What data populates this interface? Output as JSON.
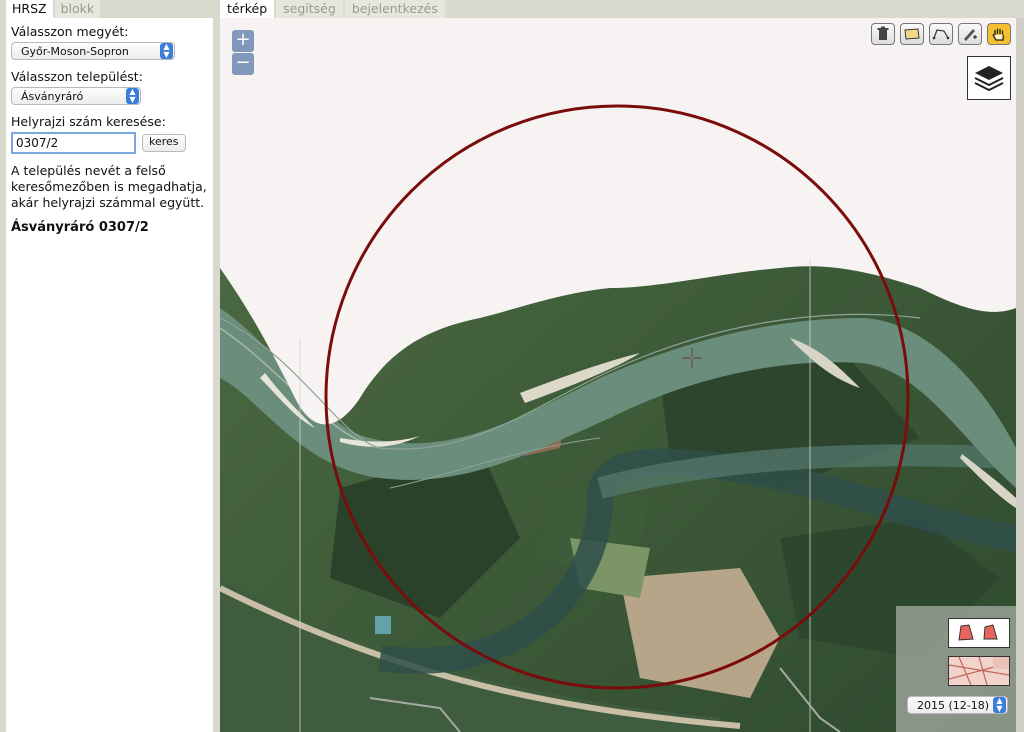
{
  "sidebar": {
    "tabs": [
      "HRSZ",
      "blokk"
    ],
    "county_label": "Válasszon megyét:",
    "county_value": "Győr-Moson-Sopron",
    "settlement_label": "Válasszon települést:",
    "settlement_value": "Ásványráró",
    "parcel_label": "Helyrajzi szám keresése:",
    "parcel_value": "0307/2",
    "search_button": "keres",
    "help_text": "A település nevét a felső keresőmezőben is megadhatja, akár helyrajzi számmal együtt.",
    "result_title": "Ásványráró 0307/2"
  },
  "main_tabs": [
    "térkép",
    "segítség",
    "bejelentkezés"
  ],
  "map": {
    "zoom_in": "+",
    "zoom_out": "−",
    "tools": [
      "trash-icon",
      "polygon-select-icon",
      "polyline-icon",
      "draw-pencil-icon",
      "pan-hand-icon"
    ],
    "active_tool": "pan-hand-icon",
    "year_value": "2015 (12-18)",
    "circle_color": "#7a0c0c"
  }
}
